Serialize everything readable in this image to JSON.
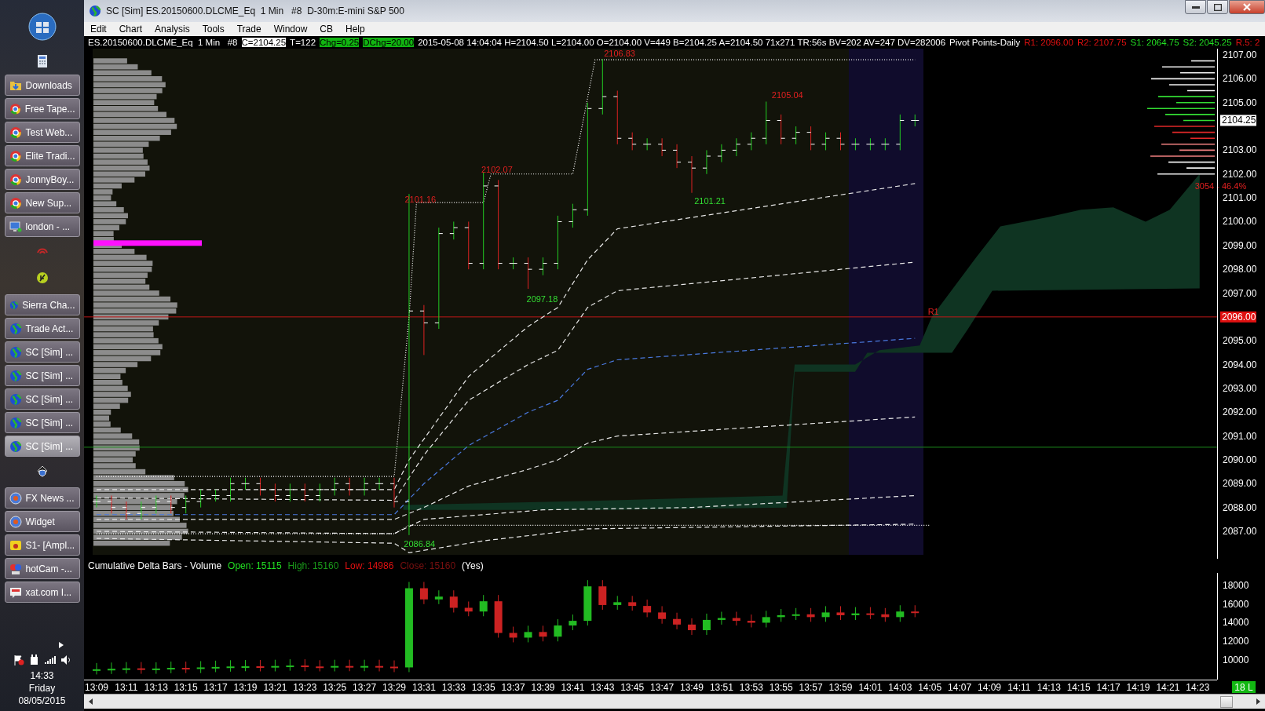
{
  "taskbar": {
    "items": [
      {
        "kind": "folder",
        "label": "Downloads",
        "selected": false
      },
      {
        "kind": "browser",
        "label": "Free Tape...",
        "selected": false
      },
      {
        "kind": "browser",
        "label": "Test Web...",
        "selected": false
      },
      {
        "kind": "browser",
        "label": "Elite Tradi...",
        "selected": false
      },
      {
        "kind": "browser",
        "label": "JonnyBoy...",
        "selected": false
      },
      {
        "kind": "browser",
        "label": "New Sup...",
        "selected": false
      },
      {
        "kind": "monitor",
        "label": "london - ...",
        "selected": false
      },
      {
        "kind": "swirl"
      },
      {
        "kind": "leaf"
      },
      {
        "kind": "globe",
        "label": "Sierra Cha...",
        "selected": false
      },
      {
        "kind": "globe",
        "label": "Trade Act...",
        "selected": false
      },
      {
        "kind": "globe",
        "label": "SC [Sim] ...",
        "selected": false
      },
      {
        "kind": "globe",
        "label": "SC [Sim] ...",
        "selected": false
      },
      {
        "kind": "globe",
        "label": "SC [Sim] ...",
        "selected": false
      },
      {
        "kind": "globe",
        "label": "SC [Sim] ...",
        "selected": false
      },
      {
        "kind": "globe",
        "label": "SC [Sim] ...",
        "selected": true
      },
      {
        "kind": "shield"
      },
      {
        "kind": "orb",
        "label": "FX News ...",
        "selected": false
      },
      {
        "kind": "orb",
        "label": "Widget",
        "selected": false
      },
      {
        "kind": "camera",
        "label": "S1- [Ampl...",
        "selected": false
      },
      {
        "kind": "webcam",
        "label": "hotCam -...",
        "selected": false
      },
      {
        "kind": "chat",
        "label": "xat.com I...",
        "selected": false
      }
    ],
    "clock": {
      "time": "14:33",
      "day": "Friday",
      "date": "08/05/2015"
    }
  },
  "window": {
    "title": "SC [Sim] ES.20150600.DLCME_Eq  1 Min   #8  D-30m:E-mini S&P 500"
  },
  "menu": [
    "Edit",
    "Chart",
    "Analysis",
    "Tools",
    "Trade",
    "Window",
    "CB",
    "Help"
  ],
  "info_line": [
    {
      "text": "ES.20150600.DLCME_Eq  1 Min   #8",
      "kind": "plain",
      "color": "#ffffff"
    },
    {
      "text": "C=2104.25",
      "kind": "inverse"
    },
    {
      "text": "T=122",
      "kind": "plain",
      "color": "#ffffff"
    },
    {
      "text": "Chg=0.25",
      "kind": "highlight"
    },
    {
      "text": "DChg=20.00",
      "kind": "highlight"
    },
    {
      "text": "2015-05-08 14:04:04 H=2104.50 L=2104.00 O=2104.00 V=449 B=2104.25 A=2104.50 71x271 TR:56s BV=202 AV=247 DV=282006",
      "kind": "plain",
      "color": "#ffffff"
    },
    {
      "text": "Pivot Points-Daily",
      "kind": "plain",
      "color": "#ffffff"
    },
    {
      "text": "R1: 2096.00",
      "kind": "plain",
      "color": "#e01010"
    },
    {
      "text": "R2: 2107.75",
      "kind": "plain",
      "color": "#e01010"
    },
    {
      "text": "S1: 2064.75",
      "kind": "plain",
      "color": "#22dd22"
    },
    {
      "text": "S2: 2045.25",
      "kind": "plain",
      "color": "#22dd22"
    },
    {
      "text": "R.5: 2",
      "kind": "plain",
      "color": "#e01010"
    }
  ],
  "price_chart": {
    "annotations": [
      {
        "text": "2106.83",
        "kind": "high"
      },
      {
        "text": "2102.07",
        "kind": "high"
      },
      {
        "text": "2101.16",
        "kind": "high"
      },
      {
        "text": "2105.04",
        "kind": "high"
      },
      {
        "text": "2101.21",
        "kind": "low"
      },
      {
        "text": "2097.18",
        "kind": "low"
      },
      {
        "text": "2086.84",
        "kind": "low"
      },
      {
        "text": "R1",
        "kind": "pivot"
      },
      {
        "text": "3054 - 46.4%",
        "kind": "pivot"
      }
    ],
    "price_axis": [
      "2107.00",
      "2106.00",
      "2105.00",
      "2103.00",
      "2102.00",
      "2101.00",
      "2100.00",
      "2099.00",
      "2098.00",
      "2097.00",
      "2095.00",
      "2094.00",
      "2093.00",
      "2092.00",
      "2091.00",
      "2090.00",
      "2089.00",
      "2088.00",
      "2087.00"
    ],
    "markers": [
      {
        "text": "2104.25",
        "kind": "last"
      },
      {
        "text": "2096.00",
        "kind": "pivot"
      }
    ]
  },
  "delta_chart": {
    "legend": [
      {
        "text": "Cumulative Delta Bars - Volume",
        "color": "#ffffff"
      },
      {
        "text": "Open: 15115",
        "color": "#22dd22"
      },
      {
        "text": "High: 15160",
        "color": "#1a9a1a"
      },
      {
        "text": "Low: 14986",
        "color": "#dd1111"
      },
      {
        "text": "Close: 15160",
        "color": "#7a1010"
      },
      {
        "text": "(Yes)",
        "color": "#ffffff"
      }
    ],
    "axis": [
      "18000",
      "16000",
      "14000",
      "12000",
      "10000"
    ]
  },
  "time_axis": [
    "13:09",
    "13:11",
    "13:13",
    "13:15",
    "13:17",
    "13:19",
    "13:21",
    "13:23",
    "13:25",
    "13:27",
    "13:29",
    "13:31",
    "13:33",
    "13:35",
    "13:37",
    "13:39",
    "13:41",
    "13:43",
    "13:45",
    "13:47",
    "13:49",
    "13:51",
    "13:53",
    "13:55",
    "13:57",
    "13:59",
    "14:01",
    "14:03",
    "14:05",
    "14:07",
    "14:09",
    "14:11",
    "14:13",
    "14:15",
    "14:17",
    "14:19",
    "14:21",
    "14:23"
  ],
  "status": "18 L"
}
